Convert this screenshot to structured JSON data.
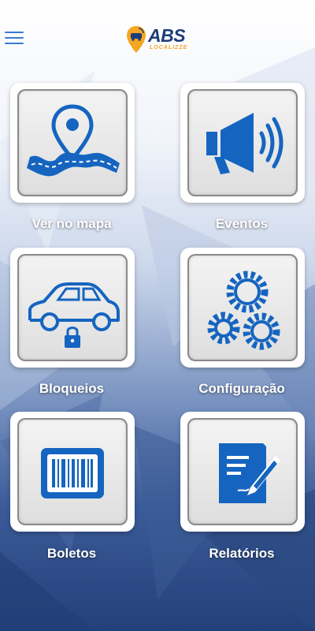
{
  "app": {
    "logo_text": "ABS",
    "logo_subtext": "LOCALIZZE"
  },
  "menu": {
    "items": [
      {
        "label": "Ver no mapa",
        "icon": "map-route-icon"
      },
      {
        "label": "Eventos",
        "icon": "megaphone-icon"
      },
      {
        "label": "Bloqueios",
        "icon": "car-lock-icon"
      },
      {
        "label": "Configuração",
        "icon": "gears-icon"
      },
      {
        "label": "Boletos",
        "icon": "barcode-icon"
      },
      {
        "label": "Relatórios",
        "icon": "report-pen-icon"
      }
    ]
  },
  "colors": {
    "icon_blue": "#1565c0",
    "brand_dark": "#1e3c78",
    "brand_orange": "#f5a623",
    "menu_icon": "#3a7bd5"
  }
}
